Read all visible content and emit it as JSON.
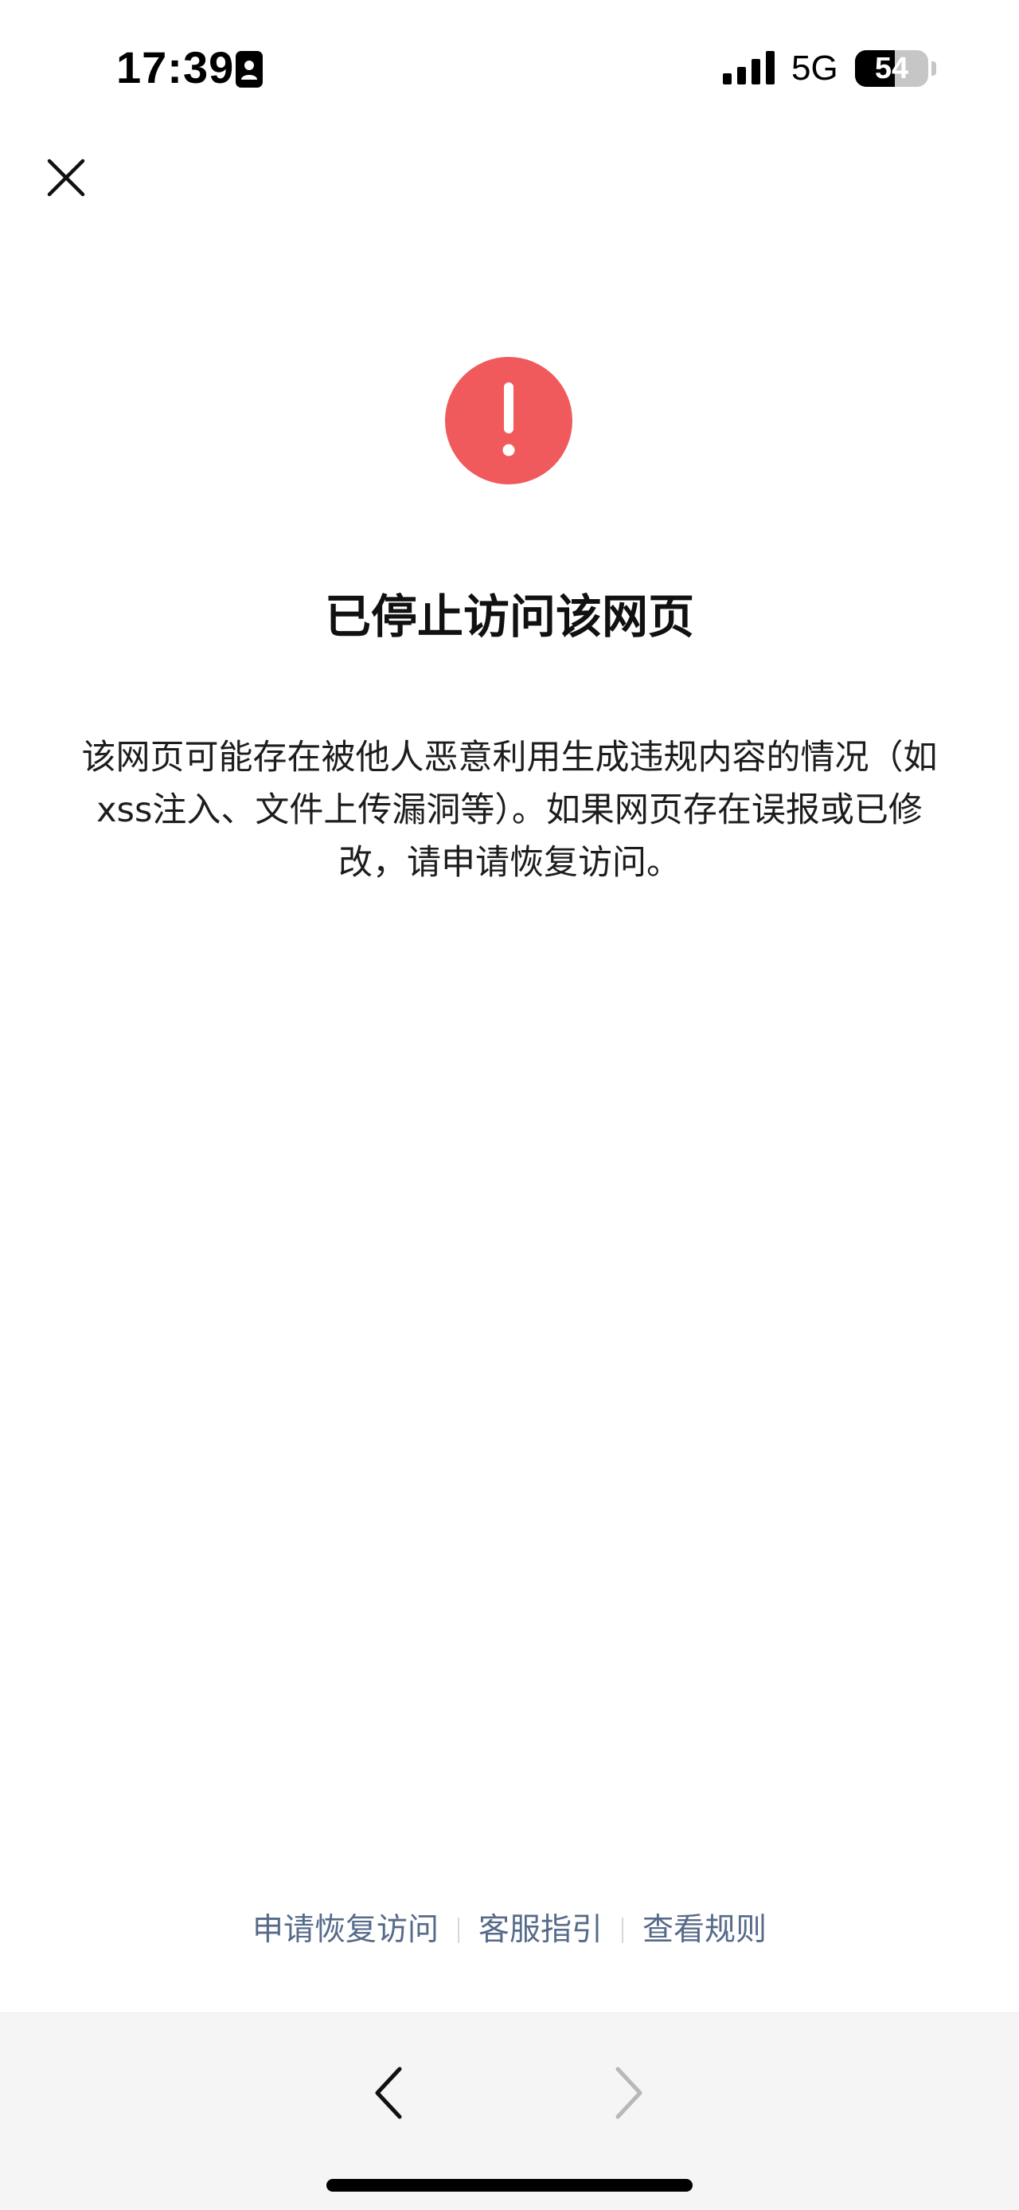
{
  "status_bar": {
    "time": "17:39",
    "network": "5G",
    "battery_level": "54",
    "battery_percent": 54
  },
  "icons": {
    "close": "close-icon",
    "alert": "exclamation-circle-icon",
    "back": "chevron-left-icon",
    "forward": "chevron-right-icon"
  },
  "colors": {
    "alert_red": "#F15A5C",
    "link_blue_gray": "#566A89",
    "nav_background": "#F5F5F5"
  },
  "main": {
    "title": "已停止访问该网页",
    "description": "该网页可能存在被他人恶意利用生成违规内容的情况（如xss注入、文件上传漏洞等）。如果网页存在误报或已修改，请申请恢复访问。"
  },
  "footer_links": {
    "request_restore": "申请恢复访问",
    "customer_service": "客服指引",
    "view_rules": "查看规则"
  }
}
